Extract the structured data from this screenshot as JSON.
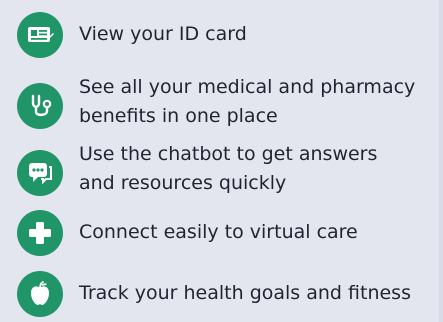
{
  "features": [
    {
      "icon": "id-card-icon",
      "label_lines": [
        "View your ID card"
      ]
    },
    {
      "icon": "stethoscope-icon",
      "label_lines": [
        "See all your medical and pharmacy",
        "benefits in one place"
      ]
    },
    {
      "icon": "chatbot-icon",
      "label_lines": [
        "Use the chatbot to get answers",
        "and resources quickly"
      ]
    },
    {
      "icon": "medical-cross-icon",
      "label_lines": [
        "Connect easily to virtual care"
      ]
    },
    {
      "icon": "apple-icon",
      "label_lines": [
        "Track your health goals and fitness"
      ]
    }
  ],
  "colors": {
    "background": "#e4e6ef",
    "icon_background": "#1f9568",
    "text": "#1f2430"
  }
}
